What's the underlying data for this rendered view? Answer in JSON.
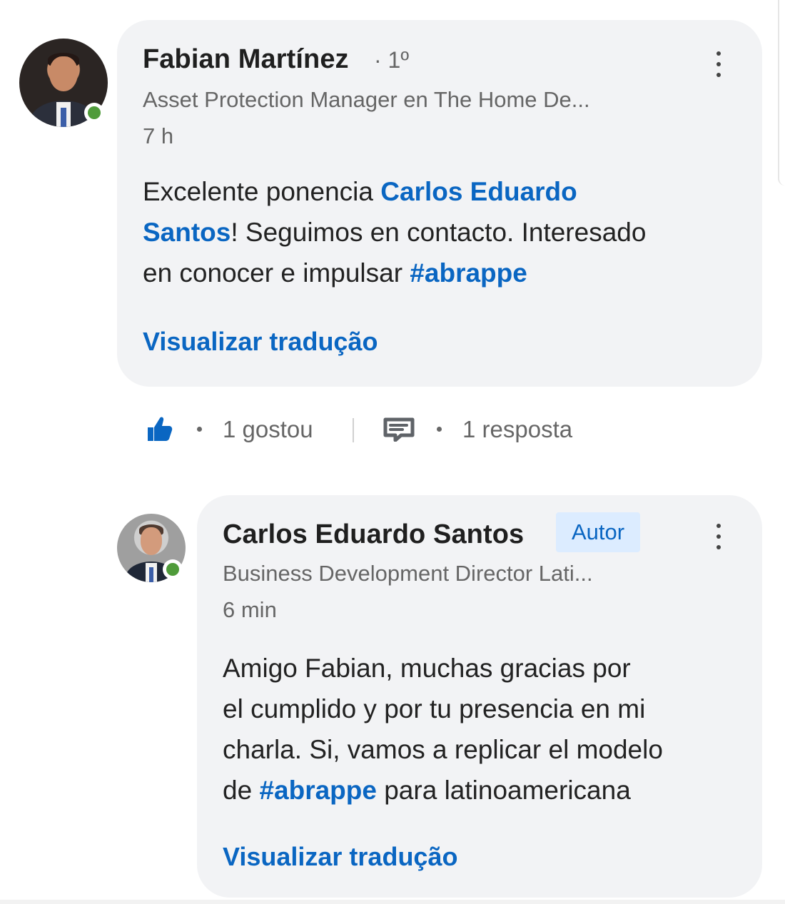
{
  "comments": [
    {
      "author_name": "Fabian Martínez",
      "degree": "· 1º",
      "headline": "Asset Protection Manager en The Home De...",
      "time": "7 h",
      "text_lines": {
        "line1_prefix": "Excelente ponencia ",
        "line1_mention": "Carlos Eduardo",
        "line2_mention": "Santos",
        "line2_suffix": "! Seguimos en contacto. Interesado",
        "line3_prefix": "en conocer e impulsar ",
        "line3_hashtag": "#abrappe"
      },
      "translate_label": "Visualizar tradução",
      "likes_label": "1 gostou",
      "reply_label": "1 resposta",
      "avatar_icon": "profile-photo-fabian",
      "more_icon": "more-vertical-icon",
      "online_color": "#4f9b3a"
    },
    {
      "author_name": "Carlos Eduardo Santos",
      "badge": "Autor",
      "headline": "Business Development Director Lati...",
      "time": "6 min",
      "text_lines": {
        "line1": "Amigo Fabian, muchas gracias por",
        "line2": "el cumplido y por tu presencia en mi",
        "line3": "charla. Si, vamos a replicar el modelo",
        "line4_prefix": "de ",
        "line4_hashtag": "#abrappe",
        "line4_suffix": " para  latinoamericana"
      },
      "translate_label": "Visualizar tradução",
      "avatar_icon": "profile-photo-carlos",
      "more_icon": "more-vertical-icon",
      "online_color": "#4f9b3a"
    }
  ],
  "colors": {
    "link": "#0a66c2",
    "bubble": "#f2f3f5",
    "muted_text": "#666666",
    "badge_bg": "#dcecff"
  },
  "icons": {
    "like": "thumbs-up-icon",
    "reply": "reply-icon"
  }
}
